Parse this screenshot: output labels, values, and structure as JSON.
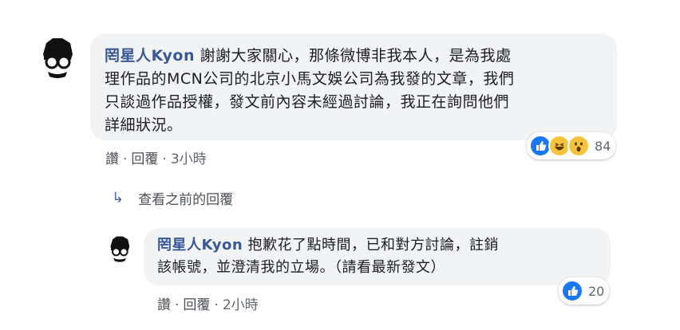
{
  "comment": {
    "author": "罔星人Kyon",
    "lines": [
      "謝謝大家關心，那條微博非我本人，是為我處",
      "理作品的MCN公司的北京小馬文娛公司為我發的文章，我們",
      "只談過作品授權，發文前內容未經過討論，我正在詢問他們",
      "詳細狀況。"
    ],
    "actions": {
      "like": "讚",
      "reply": "回覆",
      "time": "3小時",
      "separator": "·"
    },
    "reaction_count": "84",
    "reaction_icons": [
      "like-icon",
      "haha-icon",
      "wow-icon"
    ]
  },
  "view_previous": "查看之前的回覆",
  "reply": {
    "author": "罔星人Kyon",
    "lines": [
      "抱歉花了點時間，已和對方討論，註銷",
      "該帳號，並澄清我的立場。（請看最新發文）"
    ],
    "actions": {
      "like": "讚",
      "reply": "回覆",
      "time": "2小時",
      "separator": "·"
    },
    "reaction_count": "20",
    "reaction_icons": [
      "like-icon"
    ]
  },
  "colors": {
    "name": "#385898",
    "bubble": "#f2f3f5",
    "like_blue": "#1877f2"
  }
}
